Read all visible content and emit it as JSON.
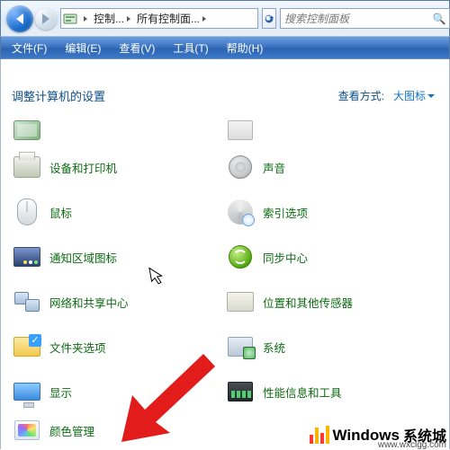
{
  "titlebar": {
    "breadcrumb": {
      "seg1": "控制...",
      "seg2": "所有控制面..."
    },
    "search_placeholder": "搜索控制面板"
  },
  "menubar": {
    "file": "文件(F)",
    "edit": "编辑(E)",
    "view": "查看(V)",
    "tools": "工具(T)",
    "help": "帮助(H)"
  },
  "content": {
    "heading": "调整计算机的设置",
    "view_label": "查看方式:",
    "view_mode": "大图标"
  },
  "left_items": {
    "i0": "",
    "i1": "设备和打印机",
    "i2": "鼠标",
    "i3": "通知区域图标",
    "i4": "网络和共享中心",
    "i5": "文件夹选项",
    "i6": "显示",
    "i7": "颜色管理"
  },
  "right_items": {
    "i0": "",
    "i1": "声音",
    "i2": "索引选项",
    "i3": "同步中心",
    "i4": "位置和其他传感器",
    "i5": "系统",
    "i6": "性能信息和工具",
    "i7": ""
  },
  "watermark": {
    "brand": "Windows",
    "cn": "系统城",
    "url": "www.wxclgg.com"
  }
}
